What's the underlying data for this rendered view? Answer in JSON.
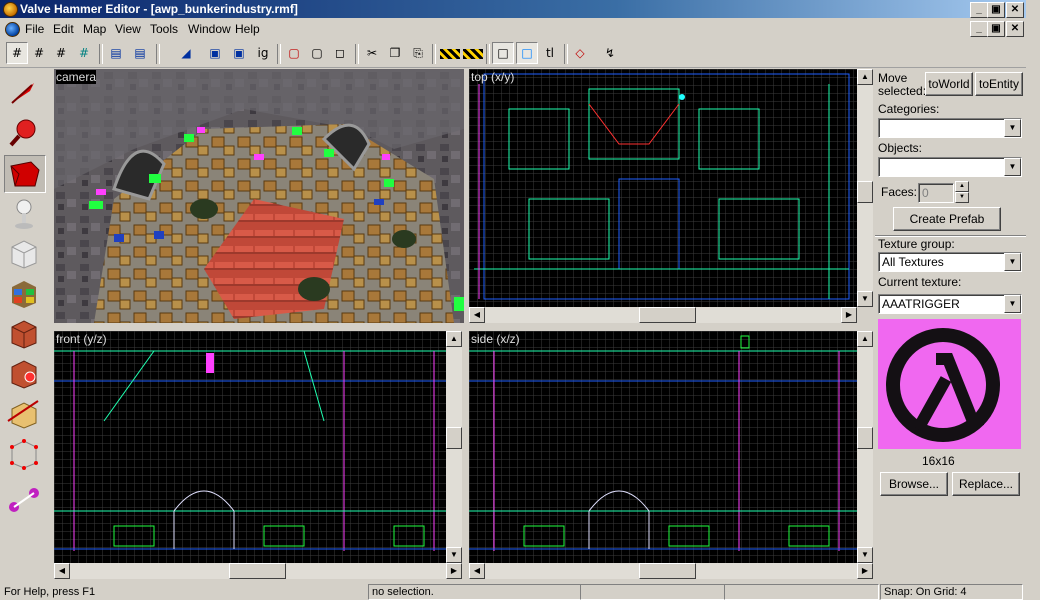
{
  "window": {
    "title": "Valve Hammer Editor - [awp_bunkerindustry.rmf]"
  },
  "menu": [
    "File",
    "Edit",
    "Map",
    "View",
    "Tools",
    "Window",
    "Help"
  ],
  "toolbar": {
    "ig_label": "ig",
    "tl_label": "tl"
  },
  "viewports": {
    "camera": "camera",
    "top": "top (x/y)",
    "front": "front (y/z)",
    "side": "side (x/z)"
  },
  "panel": {
    "move_selected_label": "Move selected:",
    "to_world_button": "toWorld",
    "to_entity_button": "toEntity",
    "categories_label": "Categories:",
    "categories_value": "",
    "objects_label": "Objects:",
    "objects_value": "",
    "faces_label": "Faces:",
    "faces_value": "0",
    "create_prefab_button": "Create Prefab",
    "texture_group_label": "Texture group:",
    "texture_group_value": "All Textures",
    "current_texture_label": "Current texture:",
    "current_texture_value": "AAATRIGGER",
    "texture_size": "16x16",
    "browse_button": "Browse...",
    "replace_button": "Replace..."
  },
  "status": {
    "help": "For Help, press F1",
    "selection": "no selection.",
    "snap": "Snap: On Grid: 4"
  },
  "colors": {
    "title_gradient_start": "#0a246a",
    "title_gradient_end": "#a6caf0",
    "grid_line": "#3c3c3c",
    "brush_green": "#00ff80",
    "brush_magenta": "#ff40ff",
    "brush_white": "#e0e0ff",
    "texture_pink": "#f068f0"
  }
}
